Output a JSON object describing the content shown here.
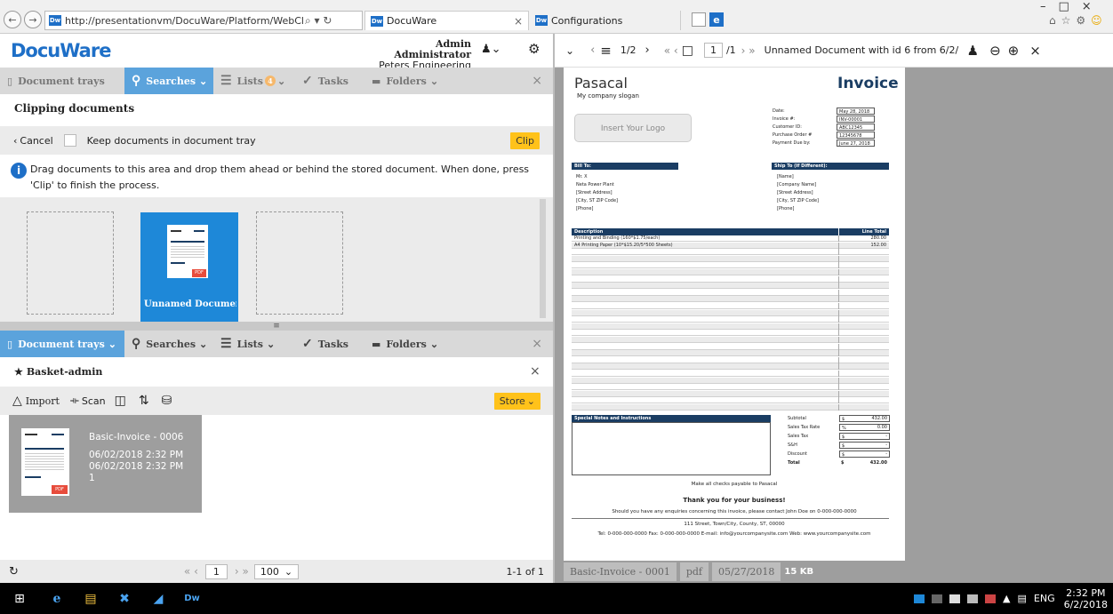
{
  "browser": {
    "url": "http://presentationvm/DocuWare/Platform/WebClien",
    "url_icons": "⌕ ▾ ↻",
    "tabs": [
      {
        "label": "DocuWare",
        "close": "×"
      },
      {
        "label": "Configurations"
      }
    ],
    "window_controls": {
      "minimize": "–",
      "maximize": "□",
      "close": "×"
    }
  },
  "header": {
    "logo": "DocuWare",
    "user_name": "Admin Administrator",
    "org": "Peters Engineering"
  },
  "top_tabs": {
    "document_trays": "Document trays",
    "searches": "Searches",
    "lists": "Lists",
    "lists_badge": "4",
    "tasks": "Tasks",
    "folders": "Folders"
  },
  "clipping": {
    "title": "Clipping documents",
    "cancel": "Cancel",
    "keep_label": "Keep documents in document tray",
    "clip": "Clip",
    "info": "Drag documents to this area and drop them ahead or behind the stored document. When done, press 'Clip' to finish the process.",
    "doc_label": "Unnamed Documen..."
  },
  "bottom_tabs": {
    "document_trays": "Document trays",
    "searches": "Searches",
    "lists": "Lists",
    "tasks": "Tasks",
    "folders": "Folders"
  },
  "basket": {
    "title": "Basket-admin",
    "import": "Import",
    "scan": "Scan",
    "store": "Store",
    "item": {
      "name": "Basic-Invoice - 0006",
      "date1": "06/02/2018 2:32 PM",
      "date2": "06/02/2018 2:32 PM",
      "pages": "1"
    }
  },
  "footer": {
    "page": "1",
    "page_size": "100",
    "count": "1-1 of 1"
  },
  "viewer": {
    "pages": "1/2",
    "page_input": "1",
    "page_total": "/1",
    "title": "Unnamed Document with id 6 from 6/2/",
    "file_name": "Basic-Invoice - 0001",
    "file_type": "pdf",
    "file_date": "05/27/2018",
    "file_size": "15 KB"
  },
  "invoice": {
    "company": "Pasacal",
    "slogan": "My company slogan",
    "heading": "Invoice",
    "logo_placeholder": "Insert Your Logo",
    "meta": [
      {
        "label": "Date:",
        "value": "May 28, 2018"
      },
      {
        "label": "Invoice #:",
        "value": "INV-00001"
      },
      {
        "label": "Customer ID:",
        "value": "ABC12345"
      },
      {
        "label": "Purchase Order #",
        "value": "12345678"
      },
      {
        "label": "Payment Due by:",
        "value": "June 27, 2018"
      }
    ],
    "bill_to_heading": "Bill To:",
    "bill_to": [
      "Mr. X",
      "Neta Power Plant",
      "[Street Address]",
      "[City, ST  ZIP Code]",
      "[Phone]"
    ],
    "ship_to_heading": "Ship To (If Different):",
    "ship_to": [
      "[Name]",
      "[Company Name]",
      "[Street Address]",
      "[City, ST  ZIP Code]",
      "[Phone]"
    ],
    "desc_heading": "Description",
    "total_heading": "Line Total",
    "lines": [
      {
        "desc": "Printing and Binding (160*$1.75/each)",
        "total": "280.00"
      },
      {
        "desc": "A4 Printing Paper (10*$15.20/5*500 Sheets)",
        "total": "152.00"
      }
    ],
    "notes_heading": "Special Notes and Instructions",
    "summary": [
      {
        "label": "Subtotal",
        "cur": "$",
        "value": "432.00"
      },
      {
        "label": "Sales Tax Rate",
        "cur": "%",
        "value": "0.00"
      },
      {
        "label": "Sales Tax",
        "cur": "$",
        "value": "-"
      },
      {
        "label": "S&H",
        "cur": "$",
        "value": "-"
      },
      {
        "label": "Discount",
        "cur": "$",
        "value": "-"
      },
      {
        "label": "Total",
        "cur": "$",
        "value": "432.00"
      }
    ],
    "payable": "Make all checks payable to Pasacal",
    "thanks": "Thank you for your business!",
    "enquiries": "Should you have any enquiries concerning this invoice, please contact John Doe on 0-000-000-0000",
    "address": "111 Street, Town/City, County, ST, 00000",
    "contact": "Tel: 0-000-000-0000 Fax: 0-000-000-0000 E-mail: info@yourcompanysite.com Web: www.yourcompanysite.com"
  },
  "taskbar": {
    "lang": "ENG",
    "time": "2:32 PM",
    "date": "6/2/2018"
  }
}
